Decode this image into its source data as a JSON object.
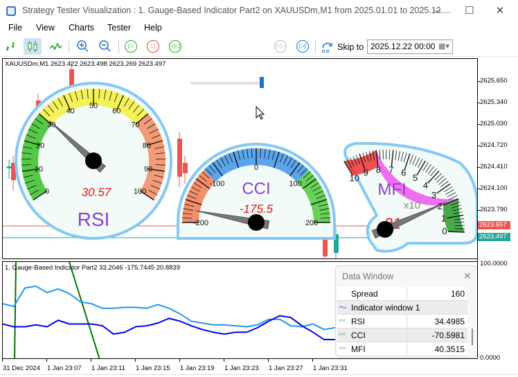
{
  "window": {
    "title": "Strategy Tester Visualization : 1. Gauge-Based Indicator Part2 on XAUUSDm,M1 from 2025.01.01 to 2025.12....",
    "minimize": "–",
    "maximize": "☐",
    "close": "✕"
  },
  "menu": [
    "File",
    "View",
    "Charts",
    "Tester",
    "Help"
  ],
  "toolbar": {
    "skip_to_label": "Skip to",
    "skip_date": "2025.12.22 00:00",
    "speed_fraction": 0.97
  },
  "chart": {
    "header": "XAUUSDm,M1  2623.422 2623.498 2623.269 2623.497",
    "price_labels": [
      "2625.650",
      "2625.340",
      "2625.030",
      "2624.720",
      "2624.410",
      "2624.100",
      "2623.790"
    ],
    "bid_label": "2623.657",
    "ask_label": "2623.497"
  },
  "gauges": {
    "rsi": {
      "title": "RSI",
      "value_text": "30.57",
      "value": 30.57,
      "min": 0,
      "max": 100,
      "labels": [
        "0",
        "10",
        "20",
        "30",
        "40",
        "50",
        "60",
        "70",
        "80",
        "90",
        "100"
      ]
    },
    "cci": {
      "title": "CCI",
      "value_text": "-175.5",
      "value": -175.5,
      "min": -200,
      "max": 200,
      "labels": [
        "-200",
        "-100",
        "0",
        "100",
        "200"
      ]
    },
    "mfi": {
      "title": "MFI",
      "value_text": "21",
      "value": 21,
      "min": 0,
      "max": 100,
      "multiplier": "x10",
      "labels": [
        "0",
        "1",
        "2",
        "3",
        "4",
        "5",
        "6",
        "7",
        "8",
        "9",
        "10"
      ]
    }
  },
  "subwindow": {
    "header": "1. Gauge-Based Indicator Part2 33.2046 -175.7445 20.8839",
    "max_label": "100.0000",
    "min_label": "0.0000",
    "series_rsi": [
      57,
      54,
      74,
      76,
      69,
      73,
      68,
      59,
      57,
      52,
      52,
      53,
      53,
      52,
      56,
      52,
      46,
      38,
      36,
      34,
      34,
      33,
      32,
      34,
      40,
      40,
      33,
      32,
      35,
      29,
      31
    ],
    "series_mfi": [
      35,
      32,
      32,
      34,
      32,
      39,
      35,
      35,
      35,
      33,
      24,
      26,
      32,
      33,
      36,
      41,
      38,
      33,
      29,
      26,
      24,
      26,
      26,
      31,
      38,
      44,
      42,
      33,
      26,
      18,
      18
    ],
    "colors": {
      "rsi": "#2196f3",
      "mfi": "#0000ee",
      "cci": "#007700"
    }
  },
  "time_labels": [
    "31 Dec 2024",
    "1 Jan 23:07",
    "1 Jan 23:11",
    "1 Jan 23:15",
    "1 Jan 23:19",
    "1 Jan 23:23",
    "1 Jan 23:27",
    "1 Jan 23:31"
  ],
  "data_window": {
    "title": "Data Window",
    "close": "✕",
    "rows": [
      {
        "name": "Spread",
        "value": "160"
      },
      {
        "name": "Indicator window 1",
        "value": ""
      },
      {
        "name": "RSI",
        "value": "34.4985"
      },
      {
        "name": "CCI",
        "value": "-70.5981"
      },
      {
        "name": "MFI",
        "value": "40.3515"
      }
    ]
  }
}
